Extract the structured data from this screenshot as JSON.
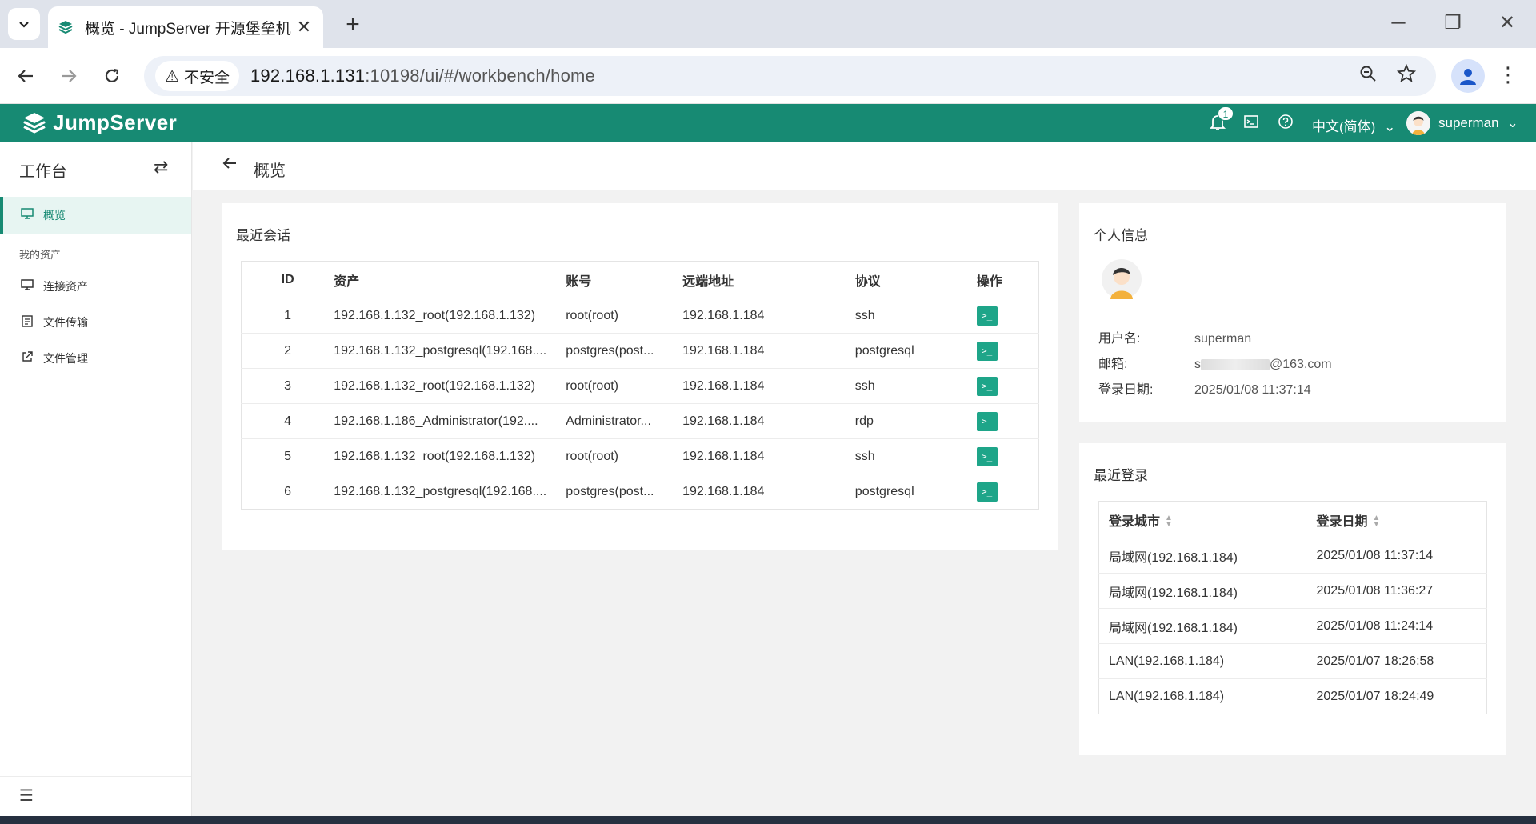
{
  "browser": {
    "tab_title": "概览 - JumpServer 开源堡垒机",
    "security_label": "不安全",
    "url_host": "192.168.1.131",
    "url_rest": ":10198/ui/#/workbench/home"
  },
  "header": {
    "logo_text": "JumpServer",
    "notification_count": "1",
    "language": "中文(简体)",
    "username": "superman"
  },
  "sidebar": {
    "title": "工作台",
    "items": [
      {
        "label": "概览",
        "icon": "monitor-icon",
        "active": true
      },
      {
        "label": "连接资产",
        "icon": "monitor-icon"
      },
      {
        "label": "文件传输",
        "icon": "file-transfer-icon"
      },
      {
        "label": "文件管理",
        "icon": "external-link-icon"
      }
    ],
    "group_label": "我的资产"
  },
  "breadcrumb": {
    "title": "概览"
  },
  "recent_sessions": {
    "title": "最近会话",
    "columns": [
      "ID",
      "资产",
      "账号",
      "远端地址",
      "协议",
      "操作"
    ],
    "rows": [
      {
        "id": "1",
        "asset": "192.168.1.132_root(192.168.1.132)",
        "account": "root(root)",
        "remote": "192.168.1.184",
        "protocol": "ssh"
      },
      {
        "id": "2",
        "asset": "192.168.1.132_postgresql(192.168....",
        "account": "postgres(post...",
        "remote": "192.168.1.184",
        "protocol": "postgresql"
      },
      {
        "id": "3",
        "asset": "192.168.1.132_root(192.168.1.132)",
        "account": "root(root)",
        "remote": "192.168.1.184",
        "protocol": "ssh"
      },
      {
        "id": "4",
        "asset": "192.168.1.186_Administrator(192....",
        "account": "Administrator...",
        "remote": "192.168.1.184",
        "protocol": "rdp"
      },
      {
        "id": "5",
        "asset": "192.168.1.132_root(192.168.1.132)",
        "account": "root(root)",
        "remote": "192.168.1.184",
        "protocol": "ssh"
      },
      {
        "id": "6",
        "asset": "192.168.1.132_postgresql(192.168....",
        "account": "postgres(post...",
        "remote": "192.168.1.184",
        "protocol": "postgresql"
      }
    ],
    "action_glyph": ">_"
  },
  "profile": {
    "title": "个人信息",
    "username_label": "用户名:",
    "username": "superman",
    "email_label": "邮箱:",
    "email_prefix": "s",
    "email_suffix": "@163.com",
    "login_label": "登录日期:",
    "login_date": "2025/01/08 11:37:14"
  },
  "recent_logins": {
    "title": "最近登录",
    "columns": [
      "登录城市",
      "登录日期"
    ],
    "rows": [
      {
        "city": "局域网(192.168.1.184)",
        "date": "2025/01/08 11:37:14"
      },
      {
        "city": "局域网(192.168.1.184)",
        "date": "2025/01/08 11:36:27"
      },
      {
        "city": "局域网(192.168.1.184)",
        "date": "2025/01/08 11:24:14"
      },
      {
        "city": "LAN(192.168.1.184)",
        "date": "2025/01/07 18:26:58"
      },
      {
        "city": "LAN(192.168.1.184)",
        "date": "2025/01/07 18:24:49"
      }
    ]
  },
  "colors": {
    "brand": "#178a73",
    "action": "#1ea589"
  }
}
